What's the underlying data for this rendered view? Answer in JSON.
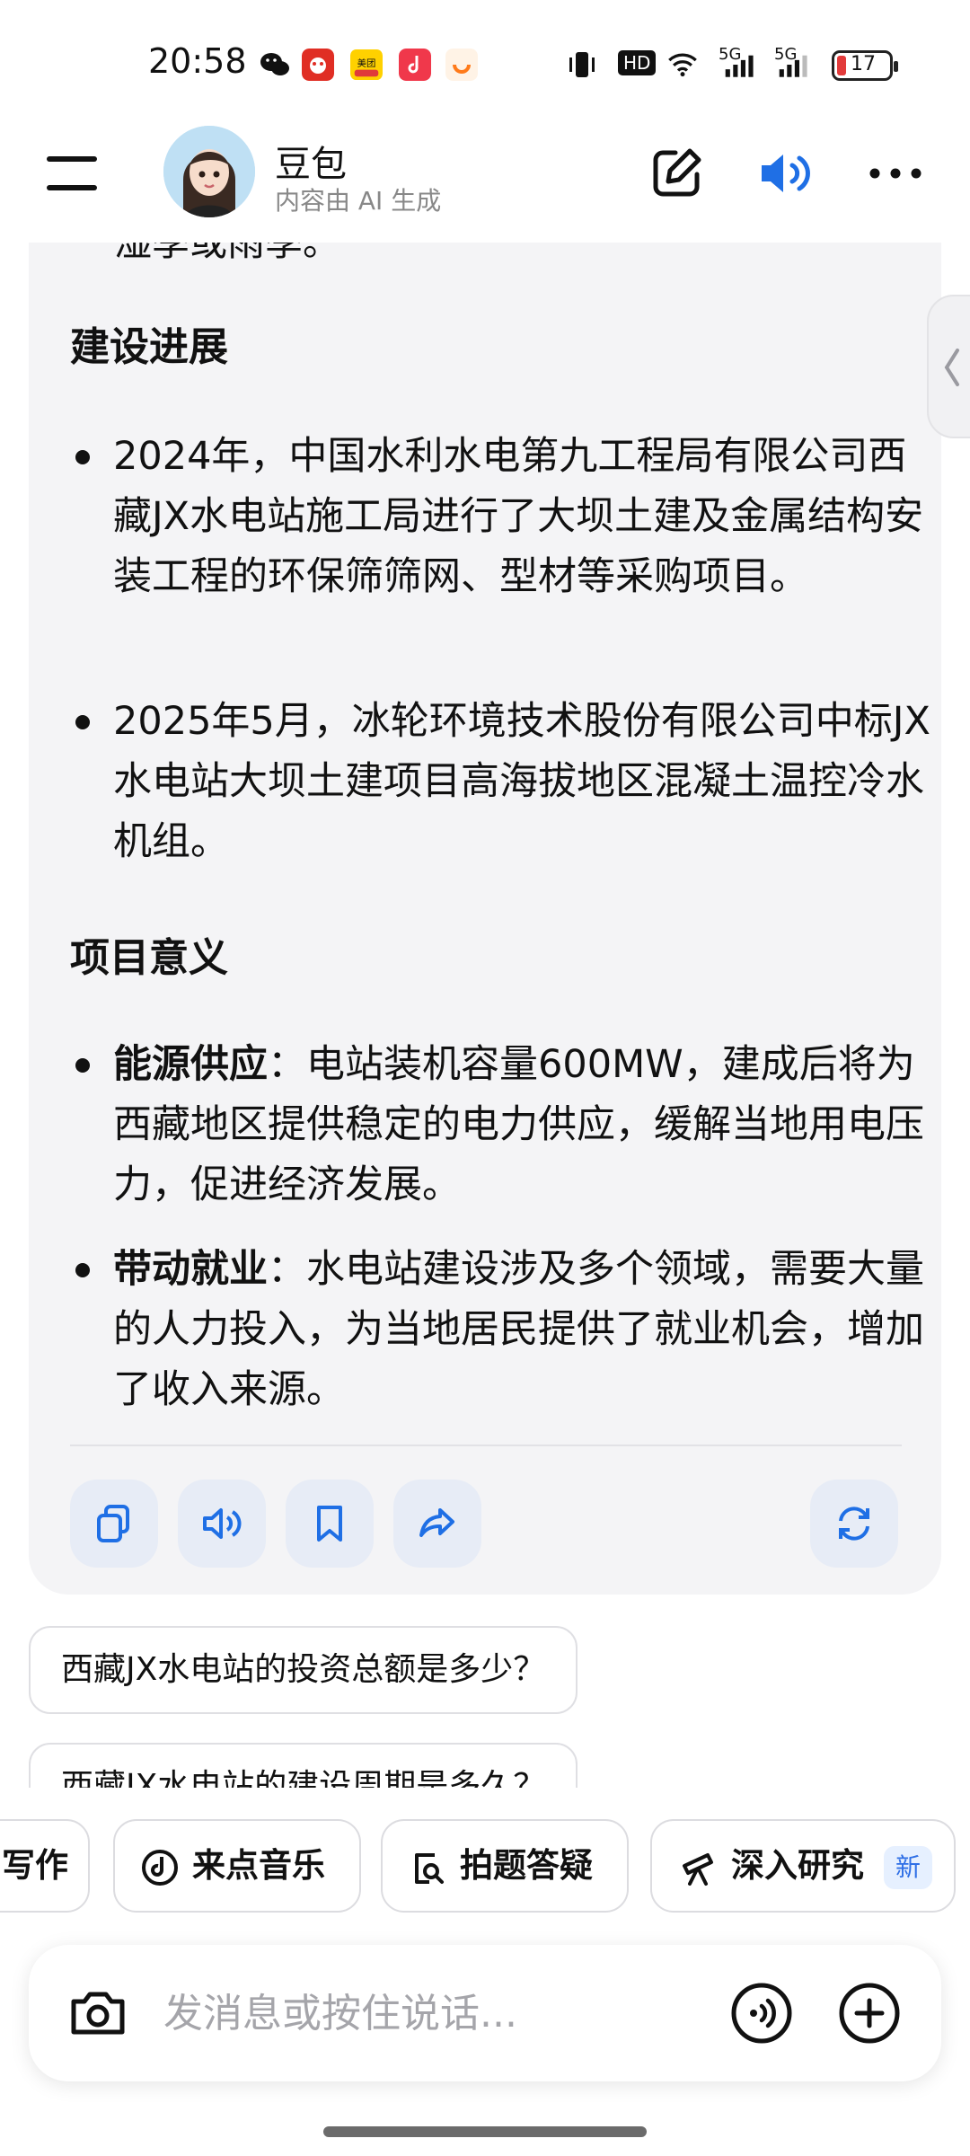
{
  "status_bar": {
    "time": "20:58",
    "hd": "HD",
    "net1": "5G",
    "net2": "5G",
    "battery": "17"
  },
  "header": {
    "bot_name": "豆包",
    "bot_subtitle": "内容由 AI 生成"
  },
  "message": {
    "truncated_top": "湿季或雨季。",
    "sections": [
      {
        "title": "建设进展",
        "items": [
          {
            "bold": "",
            "text": "2024年，中国水利水电第九工程局有限公司西藏JX水电站施工局进行了大坝土建及金属结构安装工程的环保筛筛网、型材等采购项目。"
          },
          {
            "bold": "",
            "text": "2025年5月，冰轮环境技术股份有限公司中标JX水电站大坝土建项目高海拔地区混凝土温控冷水机组。"
          }
        ]
      },
      {
        "title": "项目意义",
        "items": [
          {
            "bold": "能源供应",
            "text": "：电站装机容量600MW，建成后将为西藏地区提供稳定的电力供应，缓解当地用电压力，促进经济发展。"
          },
          {
            "bold": "带动就业",
            "text": "：水电站建设涉及多个领域，需要大量的人力投入，为当地居民提供了就业机会，增加了收入来源。"
          }
        ]
      }
    ]
  },
  "suggestions": [
    "西藏JX水电站的投资总额是多少？",
    "西藏JX水电站的建设周期是多久？"
  ],
  "chips": [
    {
      "label": "写作"
    },
    {
      "label": "来点音乐"
    },
    {
      "label": "拍题答疑"
    },
    {
      "label": "深入研究",
      "badge": "新"
    }
  ],
  "input": {
    "placeholder": "发消息或按住说话..."
  },
  "colors": {
    "accent": "#1f6fe5",
    "bubble_bg": "#f4f4f6",
    "action_bg": "#e7ecf6"
  },
  "icons": {
    "header": [
      "menu-icon",
      "edit-icon",
      "speaker-icon",
      "more-icon"
    ],
    "actions": [
      "copy-icon",
      "read-aloud-icon",
      "bookmark-icon",
      "share-icon",
      "regenerate-icon"
    ],
    "input": [
      "camera-icon",
      "voice-icon",
      "plus-icon"
    ]
  }
}
